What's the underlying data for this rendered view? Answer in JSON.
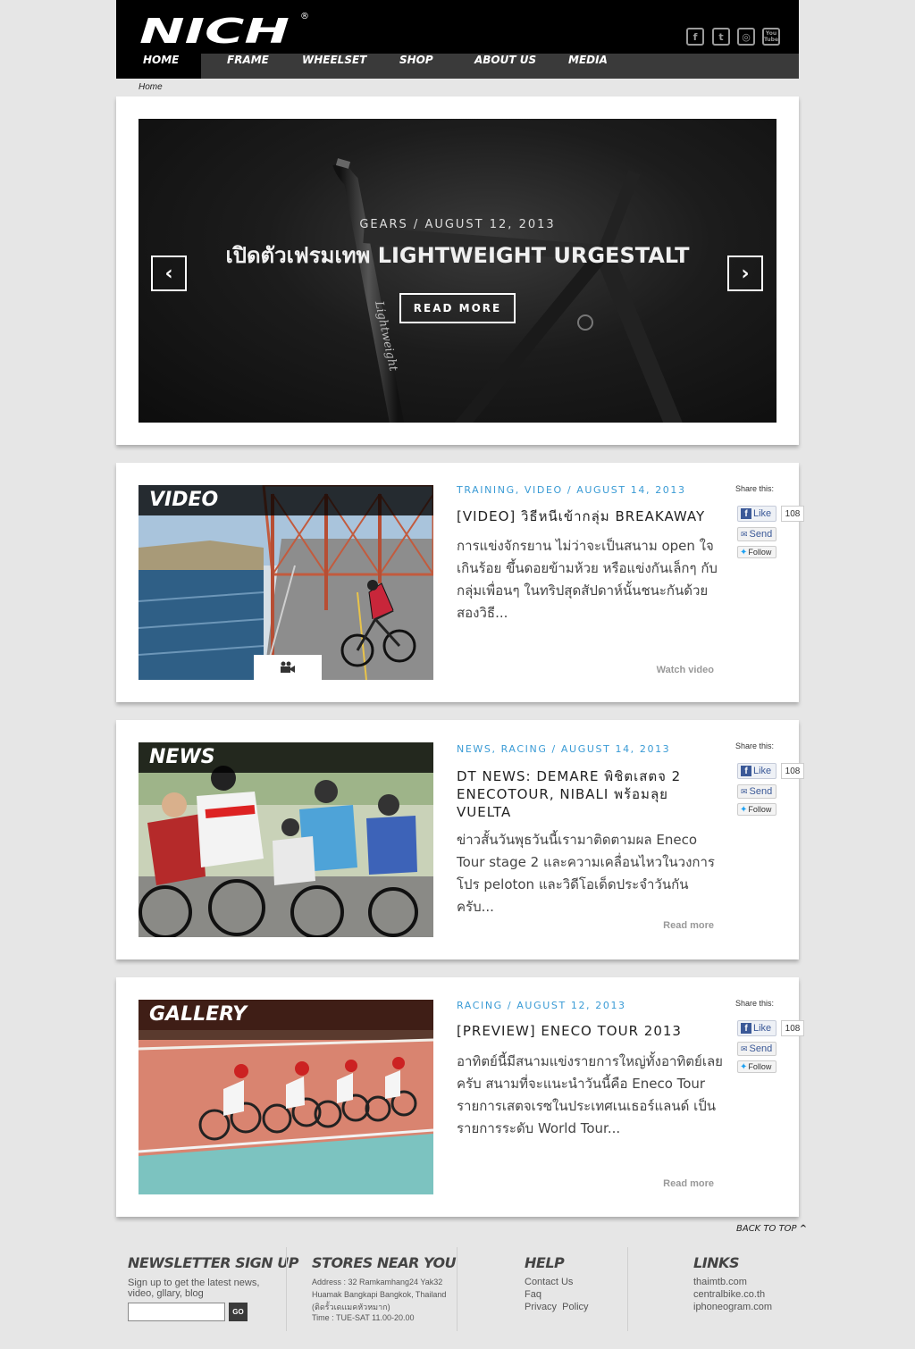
{
  "brand": {
    "logo_text": "NICH",
    "registered": "®"
  },
  "social": {
    "facebook": "f",
    "twitter": "t",
    "instagram": "◎",
    "youtube": "You Tube"
  },
  "nav": {
    "items": [
      {
        "label": "HOME"
      },
      {
        "label": "FRAME"
      },
      {
        "label": "WHEELSET"
      },
      {
        "label": "SHOP"
      },
      {
        "label": "ABOUT US"
      },
      {
        "label": "MEDIA"
      }
    ]
  },
  "breadcrumb": "Home",
  "hero": {
    "category": "GEARS  /  AUGUST 12, 2013",
    "title": "เปิดตัวเฟรมเทพ LIGHTWEIGHT URGESTALT",
    "button": "READ MORE",
    "prev": "‹",
    "next": "›",
    "frame_text": "Lightweight"
  },
  "share": {
    "label": "Share this:",
    "like": "Like",
    "count": "108",
    "send": "Send",
    "follow": "Follow"
  },
  "posts": [
    {
      "section": "VIDEO",
      "meta": "TRAINING, VIDEO  /  AUGUST 14, 2013",
      "title": "[VIDEO] วิธีหนีเข้ากลุ่ม BREAKAWAY",
      "excerpt": "การแข่งจักรยาน ไม่ว่าจะเป็นสนาม open ใจเกินร้อย ขึ้นดอยข้ามห้วย หรือแข่งกันเล็กๆ กับกลุ่มเพื่อนๆ ในทริปสุดสัปดาห์นั้นชนะกันด้วยสองวิธี...",
      "more": "Watch video",
      "video_icon": "video-camera"
    },
    {
      "section": "NEWS",
      "meta": "NEWS, RACING  /  AUGUST 14, 2013",
      "title": "DT NEWS: DEMARE พิชิตเสตจ 2 ENECOTOUR, NIBALI พร้อมลุย VUELTA",
      "excerpt": "ข่าวสั้นวันพุธวันนี้เรามาติดตามผล Eneco Tour stage 2 และความเคลื่อนไหวในวงการโปร peloton และวิดีโอเด็ดประจำวันกันครับ...",
      "more": "Read more"
    },
    {
      "section": "GALLERY",
      "meta": "RACING  /  AUGUST 12, 2013",
      "title": "[PREVIEW] ENECO TOUR 2013",
      "excerpt": "อาทิตย์นี้มีสนามแข่งรายการใหญ่ทั้งอาทิตย์เลยครับ สนามที่จะแนะนำวันนี้คือ Eneco Tour รายการเสตจเรซในประเทศเนเธอร์แลนด์ เป็นรายการระดับ World Tour...",
      "more": "Read more"
    }
  ],
  "footer": {
    "back_to_top": "BACK TO TOP",
    "newsletter": {
      "title": "NEWSLETTER SIGN UP",
      "text": "Sign up to get the latest news, video, gllary, blog",
      "input_value": "",
      "button": "GO"
    },
    "stores": {
      "title": "STORES NEAR YOU",
      "address": "Address : 32 Ramkamhang24 Yak32 Huamak Bangkapi Bangkok, Thailand (ติดรั้วเดแมคหัวหมาก)",
      "time": "Time : TUE-SAT 11.00-20.00"
    },
    "help": {
      "title": "HELP",
      "links": [
        "Contact Us",
        "Faq",
        "Privacy  Policy"
      ]
    },
    "links": {
      "title": "LINKS",
      "items": [
        "thaimtb.com",
        "centralbike.co.th",
        "iphoneogram.com"
      ]
    }
  },
  "colors": {
    "accent": "#3a9bd5",
    "header_bg": "#000000",
    "nav_bg": "#3a3a3a",
    "page_bg": "#e6e6e6"
  }
}
